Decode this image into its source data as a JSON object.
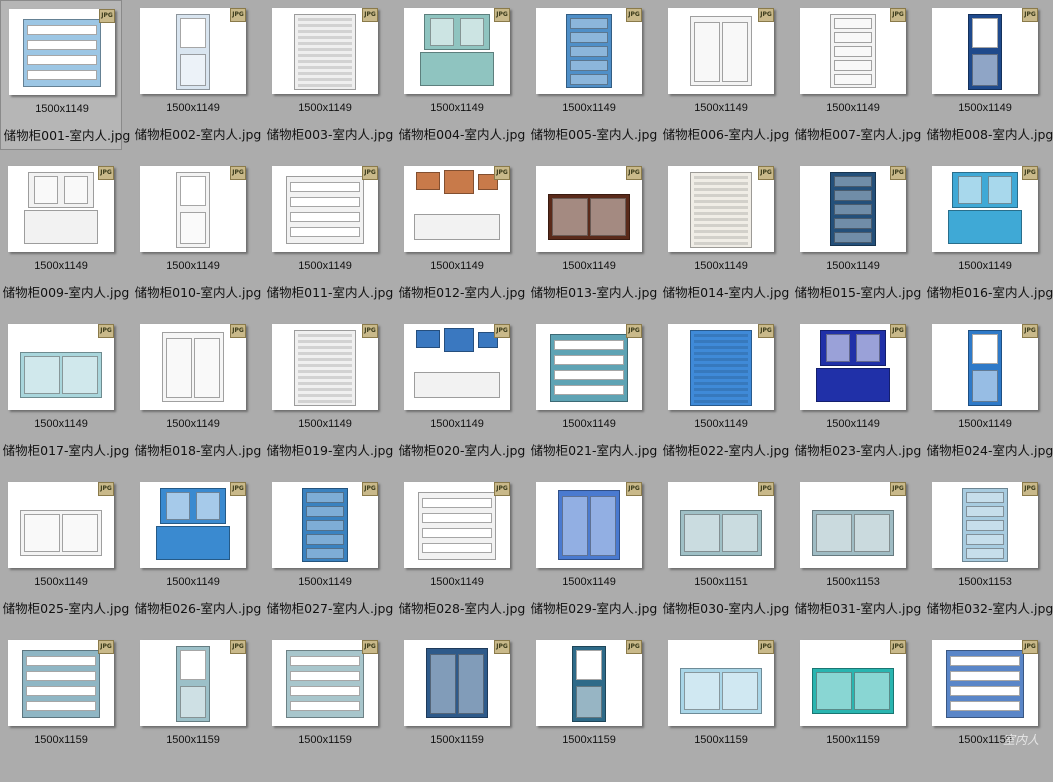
{
  "items": [
    {
      "dims": "1500x1149",
      "name": "储物柜001-室内人.jpg",
      "color": "#9cc6e4",
      "style": "shelf"
    },
    {
      "dims": "1500x1149",
      "name": "储物柜002-室内人.jpg",
      "color": "#d9e5f0",
      "style": "tall"
    },
    {
      "dims": "1500x1149",
      "name": "储物柜003-室内人.jpg",
      "color": "#efefef",
      "style": "louver"
    },
    {
      "dims": "1500x1149",
      "name": "储物柜004-室内人.jpg",
      "color": "#8fc4c0",
      "style": "hutch"
    },
    {
      "dims": "1500x1149",
      "name": "储物柜005-室内人.jpg",
      "color": "#4f8fc8",
      "style": "drawers"
    },
    {
      "dims": "1500x1149",
      "name": "储物柜006-室内人.jpg",
      "color": "#f4f4f4",
      "style": "doors"
    },
    {
      "dims": "1500x1149",
      "name": "储物柜007-室内人.jpg",
      "color": "#f4f4f4",
      "style": "drawers"
    },
    {
      "dims": "1500x1149",
      "name": "储物柜008-室内人.jpg",
      "color": "#1f4a8c",
      "style": "tall"
    },
    {
      "dims": "1500x1149",
      "name": "储物柜009-室内人.jpg",
      "color": "#f2f2f2",
      "style": "hutch"
    },
    {
      "dims": "1500x1149",
      "name": "储物柜010-室内人.jpg",
      "color": "#f4f4f4",
      "style": "tall"
    },
    {
      "dims": "1500x1149",
      "name": "储物柜011-室内人.jpg",
      "color": "#f2f2f2",
      "style": "shelf"
    },
    {
      "dims": "1500x1149",
      "name": "储物柜012-室内人.jpg",
      "color": "#c87a4a",
      "style": "wall"
    },
    {
      "dims": "1500x1149",
      "name": "储物柜013-室内人.jpg",
      "color": "#5a2a1a",
      "style": "low"
    },
    {
      "dims": "1500x1149",
      "name": "储物柜014-室内人.jpg",
      "color": "#f0ede6",
      "style": "louver"
    },
    {
      "dims": "1500x1149",
      "name": "储物柜015-室内人.jpg",
      "color": "#24507a",
      "style": "drawers"
    },
    {
      "dims": "1500x1149",
      "name": "储物柜016-室内人.jpg",
      "color": "#3fa9d6",
      "style": "hutch"
    },
    {
      "dims": "1500x1149",
      "name": "储物柜017-室内人.jpg",
      "color": "#a9d6dc",
      "style": "low"
    },
    {
      "dims": "1500x1149",
      "name": "储物柜018-室内人.jpg",
      "color": "#f6f6f6",
      "style": "doors"
    },
    {
      "dims": "1500x1149",
      "name": "储物柜019-室内人.jpg",
      "color": "#f0f0f0",
      "style": "louver"
    },
    {
      "dims": "1500x1149",
      "name": "储物柜020-室内人.jpg",
      "color": "#3a78c0",
      "style": "wall"
    },
    {
      "dims": "1500x1149",
      "name": "储物柜021-室内人.jpg",
      "color": "#5ea3b4",
      "style": "shelf"
    },
    {
      "dims": "1500x1149",
      "name": "储物柜022-室内人.jpg",
      "color": "#3f8ad8",
      "style": "louver"
    },
    {
      "dims": "1500x1149",
      "name": "储物柜023-室内人.jpg",
      "color": "#2030a8",
      "style": "hutch"
    },
    {
      "dims": "1500x1149",
      "name": "储物柜024-室内人.jpg",
      "color": "#2f7ac8",
      "style": "tall"
    },
    {
      "dims": "1500x1149",
      "name": "储物柜025-室内人.jpg",
      "color": "#f4f4f4",
      "style": "low"
    },
    {
      "dims": "1500x1149",
      "name": "储物柜026-室内人.jpg",
      "color": "#3a8ad0",
      "style": "hutch"
    },
    {
      "dims": "1500x1149",
      "name": "储物柜027-室内人.jpg",
      "color": "#3a82c0",
      "style": "drawers"
    },
    {
      "dims": "1500x1149",
      "name": "储物柜028-室内人.jpg",
      "color": "#f2f2f2",
      "style": "shelf"
    },
    {
      "dims": "1500x1149",
      "name": "储物柜029-室内人.jpg",
      "color": "#4a7ad0",
      "style": "doors"
    },
    {
      "dims": "1500x1151",
      "name": "储物柜030-室内人.jpg",
      "color": "#9fc0c6",
      "style": "low"
    },
    {
      "dims": "1500x1153",
      "name": "储物柜031-室内人.jpg",
      "color": "#9fbcc4",
      "style": "low"
    },
    {
      "dims": "1500x1153",
      "name": "储物柜032-室内人.jpg",
      "color": "#a8cce0",
      "style": "drawers"
    },
    {
      "dims": "1500x1159",
      "name": "",
      "color": "#8fb6c4",
      "style": "shelf"
    },
    {
      "dims": "1500x1159",
      "name": "",
      "color": "#9cc0c8",
      "style": "tall"
    },
    {
      "dims": "1500x1159",
      "name": "",
      "color": "#a8c6cc",
      "style": "shelf"
    },
    {
      "dims": "1500x1159",
      "name": "",
      "color": "#2e5a8a",
      "style": "doors"
    },
    {
      "dims": "1500x1159",
      "name": "",
      "color": "#2e6a88",
      "style": "tall"
    },
    {
      "dims": "1500x1159",
      "name": "",
      "color": "#a9d6e8",
      "style": "low"
    },
    {
      "dims": "1500x1159",
      "name": "",
      "color": "#29b5b0",
      "style": "low"
    },
    {
      "dims": "1500x1159",
      "name": "",
      "color": "#5a86c8",
      "style": "shelf"
    }
  ],
  "badge_text": "JPG",
  "watermark": "室内人"
}
